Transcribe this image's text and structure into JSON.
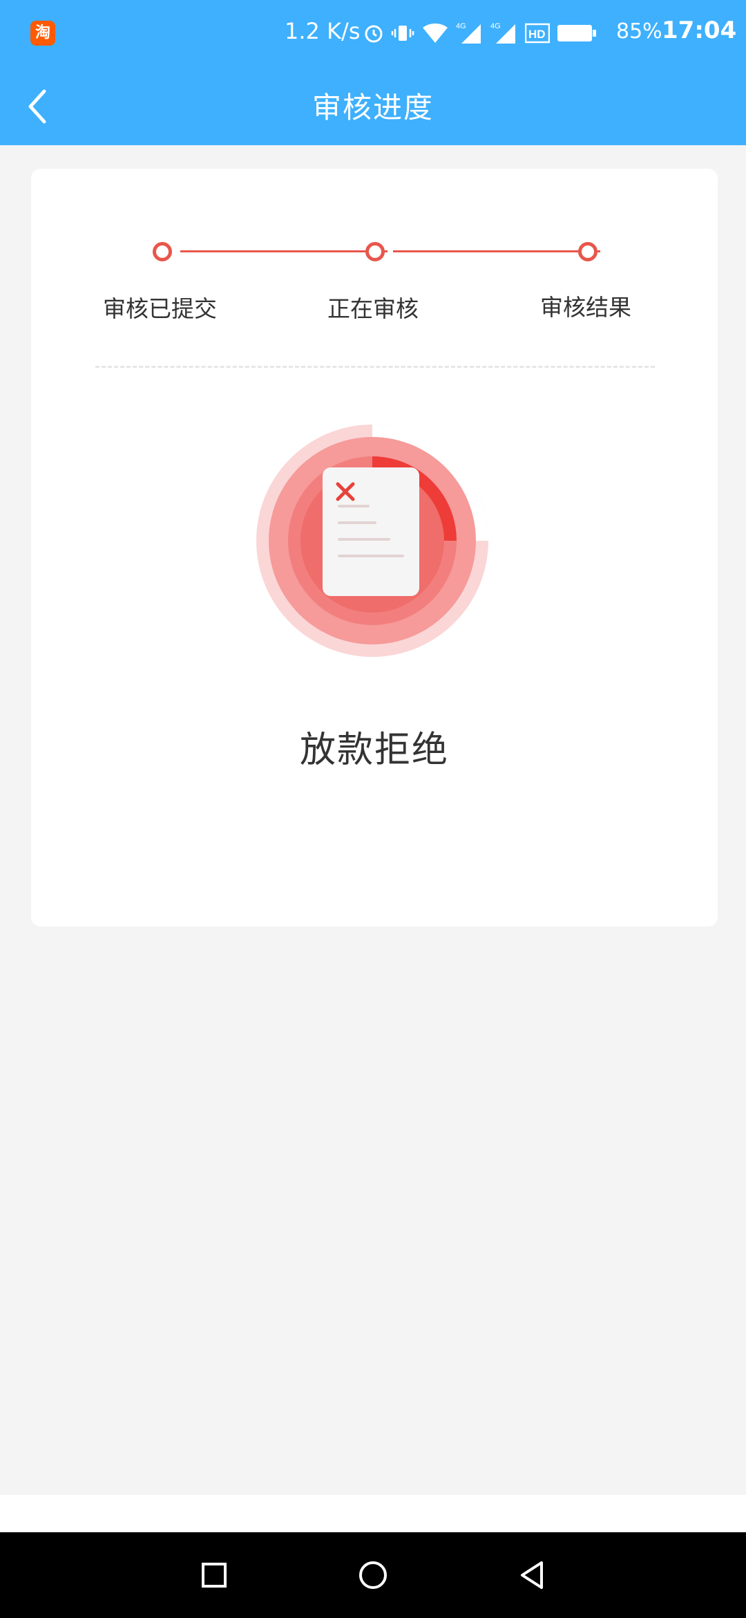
{
  "status_bar": {
    "app_icon_text": "淘",
    "net_speed": "1.2 K/s",
    "battery_percent": "85%",
    "time": "17:04",
    "icons": [
      "alarm-icon",
      "vibrate-icon",
      "wifi-icon",
      "signal-4g-icon",
      "signal-4g-icon",
      "hd-icon",
      "battery-icon"
    ]
  },
  "header": {
    "title": "审核进度",
    "back_icon": "chevron-left-icon",
    "background": "#3eb0fd"
  },
  "progress": {
    "steps": [
      {
        "label": "审核已提交"
      },
      {
        "label": "正在审核"
      },
      {
        "label": "审核结果"
      }
    ],
    "accent": "#e8564b"
  },
  "result": {
    "icon": "rejected-document-icon",
    "text": "放款拒绝",
    "color": "#ee3c38"
  },
  "nav": {
    "recent_icon": "square-icon",
    "home_icon": "circle-icon",
    "back_icon": "triangle-back-icon"
  }
}
